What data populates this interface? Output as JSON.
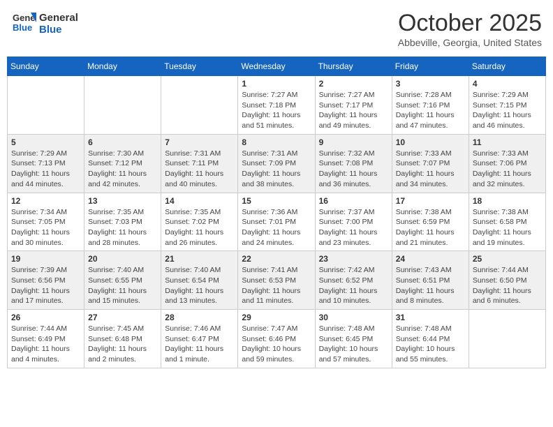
{
  "header": {
    "logo_line1": "General",
    "logo_line2": "Blue",
    "month_title": "October 2025",
    "subtitle": "Abbeville, Georgia, United States"
  },
  "weekdays": [
    "Sunday",
    "Monday",
    "Tuesday",
    "Wednesday",
    "Thursday",
    "Friday",
    "Saturday"
  ],
  "weeks": [
    [
      {
        "day": "",
        "info": ""
      },
      {
        "day": "",
        "info": ""
      },
      {
        "day": "",
        "info": ""
      },
      {
        "day": "1",
        "info": "Sunrise: 7:27 AM\nSunset: 7:18 PM\nDaylight: 11 hours\nand 51 minutes."
      },
      {
        "day": "2",
        "info": "Sunrise: 7:27 AM\nSunset: 7:17 PM\nDaylight: 11 hours\nand 49 minutes."
      },
      {
        "day": "3",
        "info": "Sunrise: 7:28 AM\nSunset: 7:16 PM\nDaylight: 11 hours\nand 47 minutes."
      },
      {
        "day": "4",
        "info": "Sunrise: 7:29 AM\nSunset: 7:15 PM\nDaylight: 11 hours\nand 46 minutes."
      }
    ],
    [
      {
        "day": "5",
        "info": "Sunrise: 7:29 AM\nSunset: 7:13 PM\nDaylight: 11 hours\nand 44 minutes."
      },
      {
        "day": "6",
        "info": "Sunrise: 7:30 AM\nSunset: 7:12 PM\nDaylight: 11 hours\nand 42 minutes."
      },
      {
        "day": "7",
        "info": "Sunrise: 7:31 AM\nSunset: 7:11 PM\nDaylight: 11 hours\nand 40 minutes."
      },
      {
        "day": "8",
        "info": "Sunrise: 7:31 AM\nSunset: 7:09 PM\nDaylight: 11 hours\nand 38 minutes."
      },
      {
        "day": "9",
        "info": "Sunrise: 7:32 AM\nSunset: 7:08 PM\nDaylight: 11 hours\nand 36 minutes."
      },
      {
        "day": "10",
        "info": "Sunrise: 7:33 AM\nSunset: 7:07 PM\nDaylight: 11 hours\nand 34 minutes."
      },
      {
        "day": "11",
        "info": "Sunrise: 7:33 AM\nSunset: 7:06 PM\nDaylight: 11 hours\nand 32 minutes."
      }
    ],
    [
      {
        "day": "12",
        "info": "Sunrise: 7:34 AM\nSunset: 7:05 PM\nDaylight: 11 hours\nand 30 minutes."
      },
      {
        "day": "13",
        "info": "Sunrise: 7:35 AM\nSunset: 7:03 PM\nDaylight: 11 hours\nand 28 minutes."
      },
      {
        "day": "14",
        "info": "Sunrise: 7:35 AM\nSunset: 7:02 PM\nDaylight: 11 hours\nand 26 minutes."
      },
      {
        "day": "15",
        "info": "Sunrise: 7:36 AM\nSunset: 7:01 PM\nDaylight: 11 hours\nand 24 minutes."
      },
      {
        "day": "16",
        "info": "Sunrise: 7:37 AM\nSunset: 7:00 PM\nDaylight: 11 hours\nand 23 minutes."
      },
      {
        "day": "17",
        "info": "Sunrise: 7:38 AM\nSunset: 6:59 PM\nDaylight: 11 hours\nand 21 minutes."
      },
      {
        "day": "18",
        "info": "Sunrise: 7:38 AM\nSunset: 6:58 PM\nDaylight: 11 hours\nand 19 minutes."
      }
    ],
    [
      {
        "day": "19",
        "info": "Sunrise: 7:39 AM\nSunset: 6:56 PM\nDaylight: 11 hours\nand 17 minutes."
      },
      {
        "day": "20",
        "info": "Sunrise: 7:40 AM\nSunset: 6:55 PM\nDaylight: 11 hours\nand 15 minutes."
      },
      {
        "day": "21",
        "info": "Sunrise: 7:40 AM\nSunset: 6:54 PM\nDaylight: 11 hours\nand 13 minutes."
      },
      {
        "day": "22",
        "info": "Sunrise: 7:41 AM\nSunset: 6:53 PM\nDaylight: 11 hours\nand 11 minutes."
      },
      {
        "day": "23",
        "info": "Sunrise: 7:42 AM\nSunset: 6:52 PM\nDaylight: 11 hours\nand 10 minutes."
      },
      {
        "day": "24",
        "info": "Sunrise: 7:43 AM\nSunset: 6:51 PM\nDaylight: 11 hours\nand 8 minutes."
      },
      {
        "day": "25",
        "info": "Sunrise: 7:44 AM\nSunset: 6:50 PM\nDaylight: 11 hours\nand 6 minutes."
      }
    ],
    [
      {
        "day": "26",
        "info": "Sunrise: 7:44 AM\nSunset: 6:49 PM\nDaylight: 11 hours\nand 4 minutes."
      },
      {
        "day": "27",
        "info": "Sunrise: 7:45 AM\nSunset: 6:48 PM\nDaylight: 11 hours\nand 2 minutes."
      },
      {
        "day": "28",
        "info": "Sunrise: 7:46 AM\nSunset: 6:47 PM\nDaylight: 11 hours\nand 1 minute."
      },
      {
        "day": "29",
        "info": "Sunrise: 7:47 AM\nSunset: 6:46 PM\nDaylight: 10 hours\nand 59 minutes."
      },
      {
        "day": "30",
        "info": "Sunrise: 7:48 AM\nSunset: 6:45 PM\nDaylight: 10 hours\nand 57 minutes."
      },
      {
        "day": "31",
        "info": "Sunrise: 7:48 AM\nSunset: 6:44 PM\nDaylight: 10 hours\nand 55 minutes."
      },
      {
        "day": "",
        "info": ""
      }
    ]
  ]
}
